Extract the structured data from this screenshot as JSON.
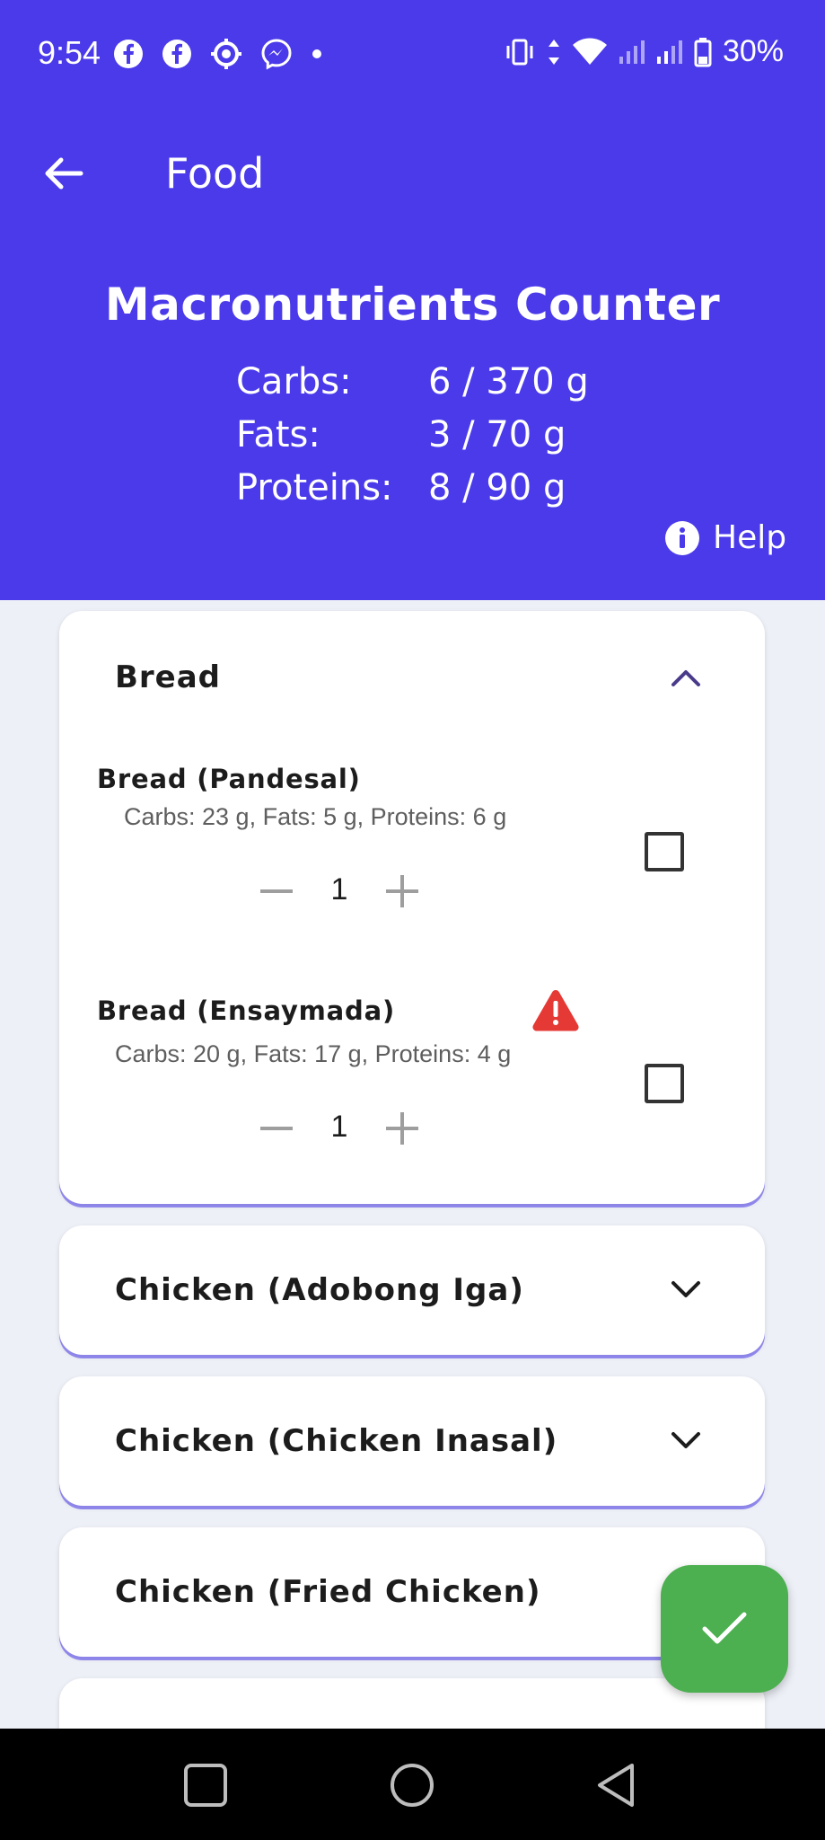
{
  "status_bar": {
    "time": "9:54",
    "battery": "30%",
    "left_icons": [
      "facebook-icon",
      "facebook-icon",
      "settings-gear-icon",
      "messenger-icon",
      "dot-icon"
    ],
    "right_icons": [
      "vibrate-icon",
      "data-arrows-icon",
      "wifi-icon",
      "signal-icon",
      "signal-icon",
      "battery-icon"
    ]
  },
  "appbar": {
    "title": "Food"
  },
  "counter": {
    "title": "Macronutrients Counter",
    "rows": [
      {
        "label": "Carbs:",
        "value": "6 / 370 g"
      },
      {
        "label": "Fats:",
        "value": "3 / 70 g"
      },
      {
        "label": "Proteins:",
        "value": "8 / 90 g"
      }
    ],
    "help_label": "Help"
  },
  "categories": [
    {
      "title": "Bread",
      "expanded": true,
      "items": [
        {
          "name": "Bread (Pandesal)",
          "macros": "Carbs: 23 g, Fats: 5 g, Proteins: 6 g",
          "quantity": "1",
          "warning": false,
          "checked": false
        },
        {
          "name": "Bread (Ensaymada)",
          "macros": "Carbs: 20 g, Fats: 17 g, Proteins: 4 g",
          "quantity": "1",
          "warning": true,
          "checked": false
        }
      ]
    },
    {
      "title": "Chicken (Adobong Iga)",
      "expanded": false
    },
    {
      "title": "Chicken (Chicken Inasal)",
      "expanded": false
    },
    {
      "title": "Chicken (Fried Chicken)",
      "expanded": false
    }
  ],
  "colors": {
    "primary": "#4a3aea",
    "fab": "#4caf50",
    "warning": "#e53935",
    "chevron": "#4a3a8a"
  }
}
